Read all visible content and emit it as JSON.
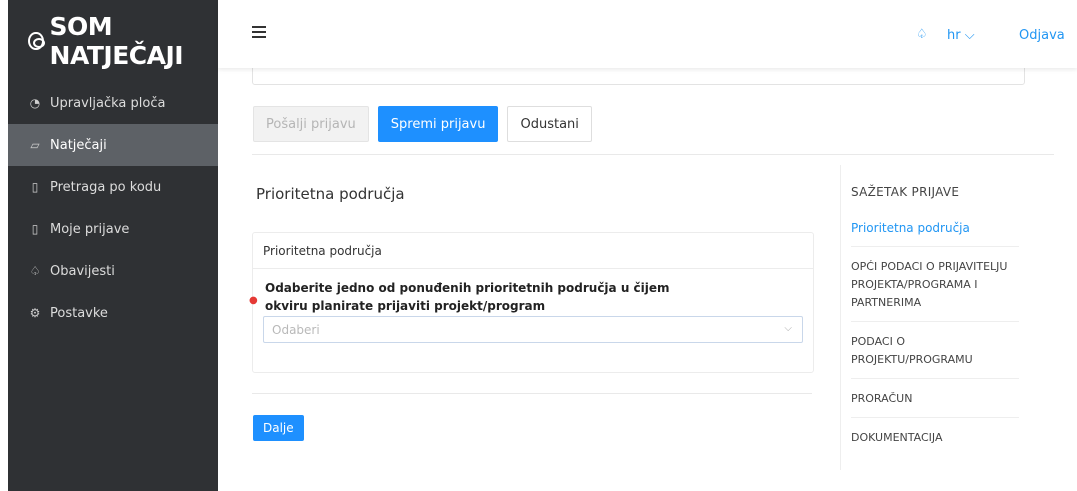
{
  "sidebar": {
    "logo_text": "SOM NATJEČAJI",
    "items": [
      {
        "label": "Upravljačka ploča",
        "icon": "dashboard-icon",
        "active": false
      },
      {
        "label": "Natječaji",
        "icon": "folder-icon",
        "active": true
      },
      {
        "label": "Pretraga po kodu",
        "icon": "document-search-icon",
        "active": false
      },
      {
        "label": "Moje prijave",
        "icon": "document-icon",
        "active": false
      },
      {
        "label": "Obavijesti",
        "icon": "bell-icon",
        "active": false
      },
      {
        "label": "Postavke",
        "icon": "gear-icon",
        "active": false
      }
    ]
  },
  "topbar": {
    "language": "hr",
    "logout": "Odjava"
  },
  "actions": {
    "send": "Pošalji prijavu",
    "save": "Spremi prijavu",
    "cancel": "Odustani"
  },
  "section": {
    "title": "Prioritetna područja",
    "card_title": "Prioritetna područja",
    "question": "Odaberite jedno od ponuđenih prioritetnih područja u čijem okviru planirate prijaviti projekt/program",
    "select_placeholder": "Odaberi",
    "next": "Dalje"
  },
  "summary": {
    "title": "SAŽETAK PRIJAVE",
    "items": [
      {
        "label": "Prioritetna područja",
        "active": true
      },
      {
        "label": "OPĆI PODACI O PRIJAVITELJU PROJEKTA/PROGRAMA I PARTNERIMA",
        "active": false
      },
      {
        "label": "PODACI O PROJEKTU/PROGRAMU",
        "active": false
      },
      {
        "label": "PRORAČUN",
        "active": false
      },
      {
        "label": "DOKUMENTACIJA",
        "active": false
      }
    ]
  },
  "colors": {
    "accent": "#1e90ff",
    "sidebar_bg": "#2f3134",
    "sidebar_active": "#5d6166"
  }
}
